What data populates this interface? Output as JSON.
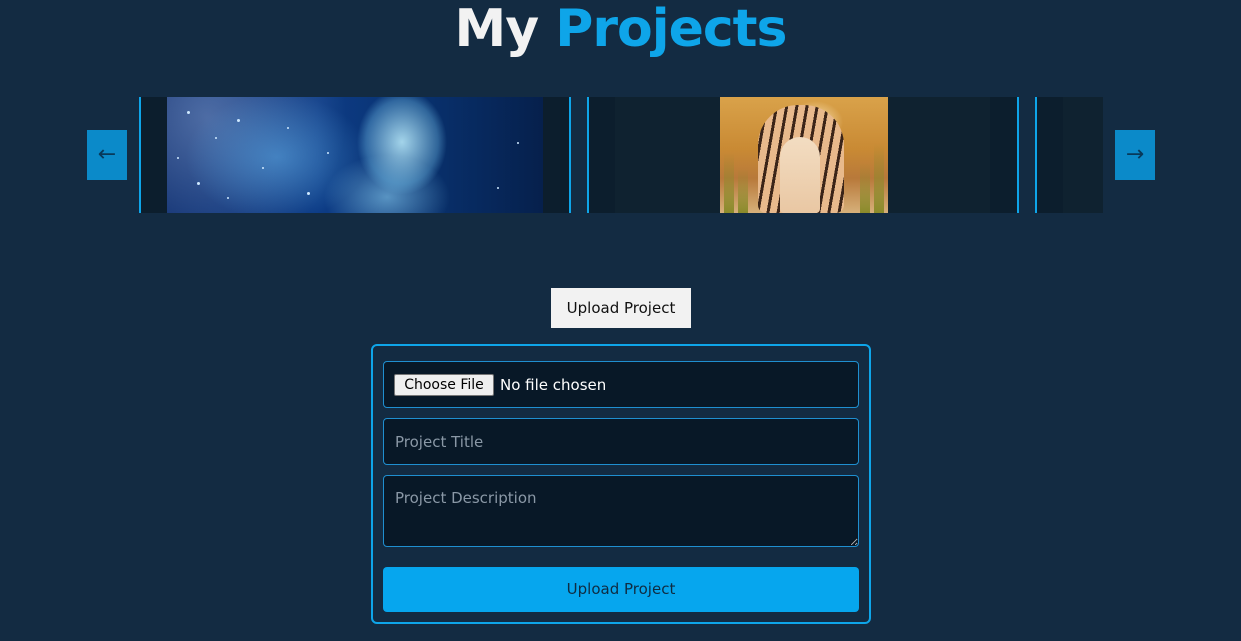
{
  "header": {
    "title_part1": "My",
    "title_part2": "Projects"
  },
  "carousel": {
    "prev_label": "←",
    "next_label": "→"
  },
  "upload_toggle_label": "Upload Project",
  "form": {
    "choose_file_label": "Choose File",
    "file_status": "No file chosen",
    "title_placeholder": "Project Title",
    "description_placeholder": "Project Description",
    "submit_label": "Upload Project"
  },
  "colors": {
    "background": "#132b42",
    "accent": "#0ea5e9",
    "button": "#06a6ee"
  }
}
